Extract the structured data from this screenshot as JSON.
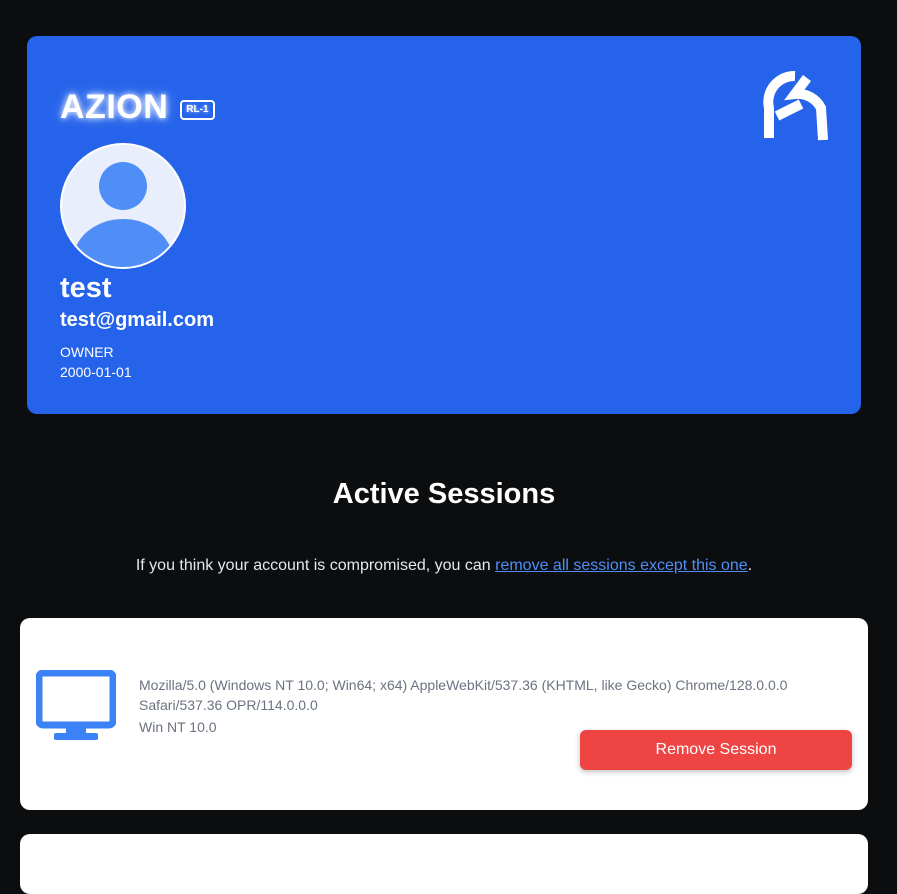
{
  "profile": {
    "brand": "AZION",
    "badge": "RL-1",
    "name": "test",
    "email": "test@gmail.com",
    "role": "OWNER",
    "date": "2000-01-01"
  },
  "icons": {
    "corner_logo": "azion-a-logo-icon",
    "avatar": "user-avatar-icon",
    "device": "desktop-monitor-icon"
  },
  "colors": {
    "card_blue": "#2563eb",
    "danger": "#ef4444",
    "link": "#4f8ef7",
    "page_bg": "#0c0d0f"
  },
  "sessions_section": {
    "title": "Active Sessions",
    "hint_before": "If you think your account is compromised, you can ",
    "hint_link": "remove all sessions except this one",
    "hint_after": "."
  },
  "sessions": [
    {
      "user_agent": "Mozilla/5.0 (Windows NT 10.0; Win64; x64) AppleWebKit/537.36 (KHTML, like Gecko) Chrome/128.0.0.0 Safari/537.36 OPR/114.0.0.0",
      "os": "Win NT 10.0",
      "remove_label": "Remove Session"
    }
  ]
}
